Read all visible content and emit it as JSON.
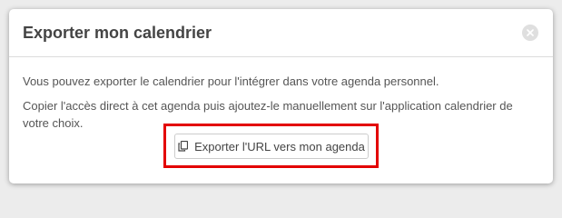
{
  "dialog": {
    "title": "Exporter mon calendrier",
    "close_icon": "close-icon",
    "paragraph_1": "Vous pouvez exporter le calendrier pour l'intégrer dans votre agenda personnel.",
    "paragraph_2": "Copier l'accès direct à cet agenda puis ajoutez-le manuellement sur l'application calendrier de votre choix.",
    "export_button_label": "Exporter l'URL vers mon agenda",
    "export_button_icon": "copy-icon"
  },
  "colors": {
    "highlight": "#e30000",
    "title": "#444444",
    "text": "#555555"
  }
}
